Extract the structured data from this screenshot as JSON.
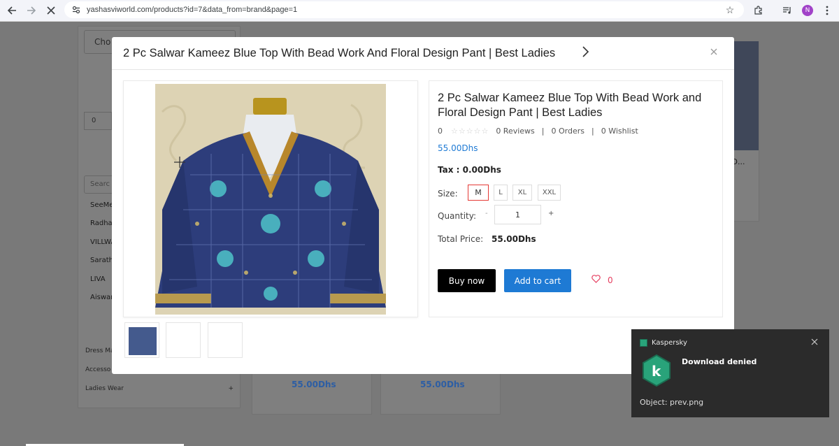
{
  "browser": {
    "url": "yashasviworld.com/products?id=7&data_from=brand&page=1",
    "profile_initial": "N"
  },
  "background_page": {
    "filter_select": "Cho",
    "price_from": "0",
    "search_placeholder": "Searc",
    "brands": [
      "SeeMe",
      "Radha",
      "VILLWA",
      "Sarath",
      "LIVA",
      "Aiswar"
    ],
    "categories": [
      {
        "label": "Dress Ma"
      },
      {
        "label": "Accesso"
      },
      {
        "label": "Ladies Wear",
        "toggle": "+"
      }
    ],
    "product_prices": [
      "55.00Dhs",
      "55.00Dhs"
    ],
    "right_product_text": "d D..."
  },
  "modal": {
    "title": "2 Pc Salwar Kameez Blue Top With Bead Work And Floral Design Pant | Best Ladies",
    "product_name": "2 Pc Salwar Kameez Blue Top With Bead Work and Floral Design Pant | Best Ladies",
    "rating": "0",
    "reviews": "0 Reviews",
    "orders": "0 Orders",
    "wishlist": "0 Wishlist",
    "price": "55.00Dhs",
    "tax_label": "Tax :",
    "tax_value": "0.00Dhs",
    "size_label": "Size:",
    "sizes": [
      "M",
      "L",
      "XL",
      "XXL"
    ],
    "selected_size": "M",
    "quantity_label": "Quantity:",
    "quantity_minus": "-",
    "quantity_value": "1",
    "quantity_plus": "+",
    "total_label": "Total Price:",
    "total_value": "55.00Dhs",
    "buy_label": "Buy now",
    "cart_label": "Add to cart",
    "wish_count": "0"
  },
  "toast": {
    "app": "Kaspersky",
    "title": "Download denied",
    "object": "Object: prev.png",
    "accent_color": "#29a37a"
  }
}
